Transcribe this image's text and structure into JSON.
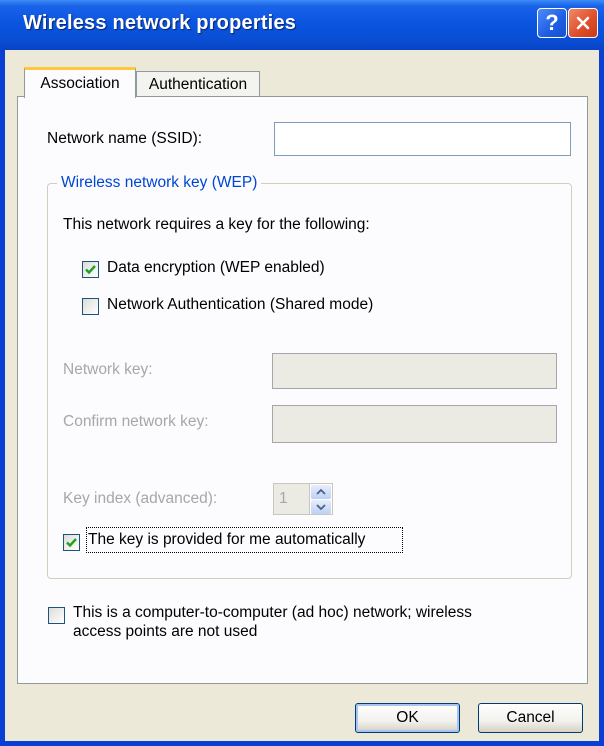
{
  "window": {
    "title": "Wireless network properties",
    "help_button": "?",
    "close_button": "close"
  },
  "tabs": [
    {
      "label": "Association",
      "active": true
    },
    {
      "label": "Authentication",
      "active": false
    }
  ],
  "association": {
    "ssid_label": "Network name (SSID):",
    "ssid_value": "",
    "group_title": "Wireless network key (WEP)",
    "requires_text": "This network requires a key for the following:",
    "data_encryption": {
      "label": "Data encryption (WEP enabled)",
      "checked": true
    },
    "network_auth": {
      "label": "Network Authentication (Shared mode)",
      "checked": false
    },
    "network_key_label": "Network key:",
    "confirm_key_label": "Confirm network key:",
    "key_index_label": "Key index (advanced):",
    "key_index_value": "1",
    "auto_key": {
      "label": "The key is provided for me automatically",
      "checked": true
    },
    "adhoc": {
      "label_line1": "This is a computer-to-computer (ad hoc) network; wireless",
      "label_line2": "access points are not used",
      "checked": false
    }
  },
  "buttons": {
    "ok": "OK",
    "cancel": "Cancel"
  },
  "colors": {
    "titlebar": "#0a55e0",
    "group_title": "#0046d5",
    "disabled_text": "#a7a6aa",
    "checkmark": "#21a121"
  }
}
